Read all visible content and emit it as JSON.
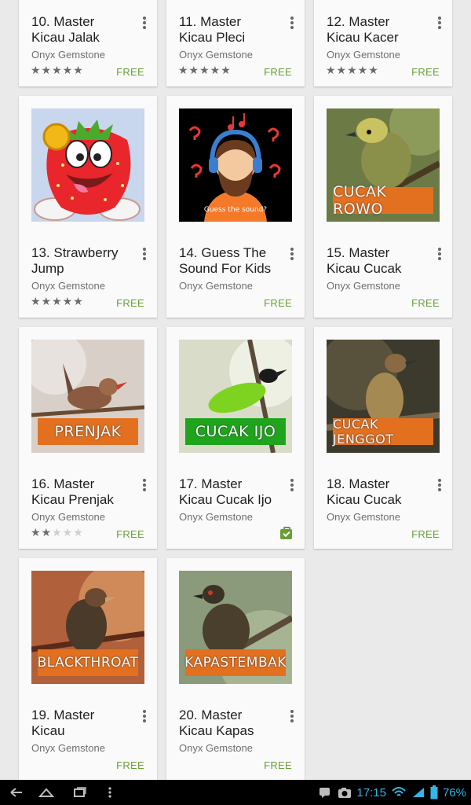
{
  "apps": [
    {
      "title": "10. Master Kicau Jalak",
      "developer": "Onyx Gemstone",
      "rating": 5,
      "price": "FREE"
    },
    {
      "title": "11. Master Kicau Pleci",
      "developer": "Onyx Gemstone",
      "rating": 5,
      "price": "FREE"
    },
    {
      "title": "12. Master Kicau Kacer",
      "developer": "Onyx Gemstone",
      "rating": 5,
      "price": "FREE"
    },
    {
      "title": "13. Strawberry Jump",
      "developer": "Onyx Gemstone",
      "rating": 5,
      "price": "FREE",
      "image": "strawberry-mascot"
    },
    {
      "title": "14. Guess The Sound For Kids",
      "developer": "Onyx Gemstone",
      "price": "FREE",
      "image": "bearded-man-headphones",
      "image_text": "Guess the sound?"
    },
    {
      "title": "15. Master Kicau Cucak",
      "developer": "Onyx Gemstone",
      "price": "FREE",
      "image": "bird-photo",
      "image_label": "CUCAK ROWO"
    },
    {
      "title": "16. Master Kicau Prenjak",
      "developer": "Onyx Gemstone",
      "rating": 2,
      "price": "FREE",
      "image": "bird-photo",
      "image_label": "PRENJAK"
    },
    {
      "title": "17. Master Kicau Cucak Ijo",
      "developer": "Onyx Gemstone",
      "owned": true,
      "image": "bird-photo",
      "image_label": "CUCAK IJO"
    },
    {
      "title": "18. Master Kicau Cucak",
      "developer": "Onyx Gemstone",
      "price": "FREE",
      "image": "bird-photo",
      "image_label": "CUCAK JENGGOT"
    },
    {
      "title": "19. Master Kicau",
      "developer": "Onyx Gemstone",
      "price": "FREE",
      "image": "bird-photo",
      "image_label": "BLACKTHROAT"
    },
    {
      "title": "20. Master Kicau Kapas",
      "developer": "Onyx Gemstone",
      "price": "FREE",
      "image": "bird-photo",
      "image_label": "KAPASTEMBAK"
    }
  ],
  "status_bar": {
    "time": "17:15",
    "battery": "76%"
  },
  "nav_icons": [
    "back-icon",
    "home-icon",
    "recent-apps-icon",
    "menu-icon"
  ],
  "colors": {
    "free": "#689f38",
    "status": "#33b5e5",
    "label_orange": "#e2701f",
    "label_green": "#1ea51c"
  }
}
